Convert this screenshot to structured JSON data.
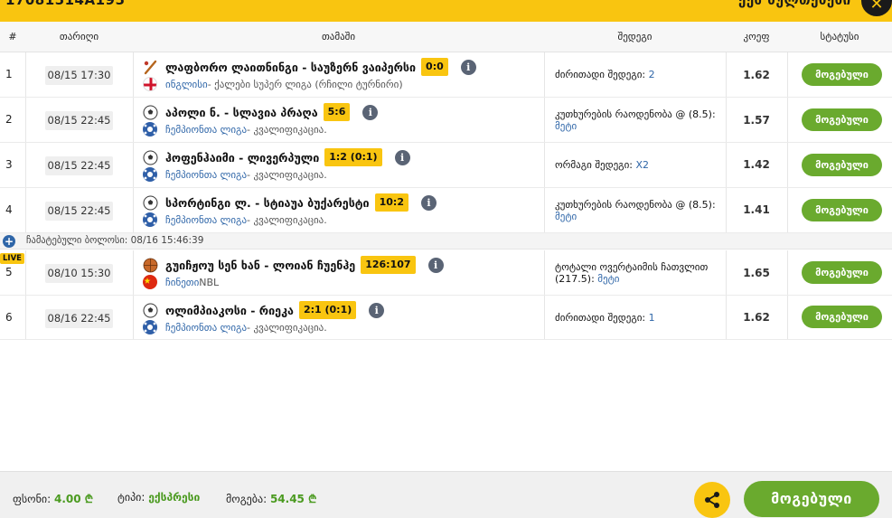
{
  "header": {
    "ticket_id": "17081514A195",
    "cashout_label": "ქეშ ბულთებები",
    "close_icon": "close-icon"
  },
  "columns": {
    "num": "#",
    "date": "თარიღი",
    "match": "თამაში",
    "result": "შედეგი",
    "odds": "კოეფ",
    "status": "სტატუსი"
  },
  "rows": [
    {
      "num": "1",
      "date": "08/15 17:30",
      "sport_icon": "cricket-icon",
      "teams": "ლაფბორო ლაითნინგი - საუზერნ ვაიპერსი",
      "score": "0:0",
      "flag_icon": "england-flag-icon",
      "league_country": "ინგლისი",
      "league_name": " - ქალები სუპერ ლიგა (რჩილი ტურნირი)",
      "market_label": "ძირითადი შედეგი: ",
      "market_sel": "2",
      "odds": "1.62",
      "status": "მოგებული"
    },
    {
      "num": "2",
      "date": "08/15 22:45",
      "sport_icon": "soccer-ball-icon",
      "teams": "აპოლი ნ. - სლავია პრაღა",
      "score": "5:6",
      "flag_icon": "globe-icon",
      "league_country": "ჩემპიონთა ლიგა",
      "league_name": " - კვალიფიკაცია.",
      "market_label": "კუთხურების რაოდენობა @ (8.5): ",
      "market_sel": "მეტი",
      "odds": "1.57",
      "status": "მოგებული"
    },
    {
      "num": "3",
      "date": "08/15 22:45",
      "sport_icon": "soccer-ball-icon",
      "teams": "ჰოფენჰაიმი - ლივერპული",
      "score": "1:2 (0:1)",
      "flag_icon": "globe-icon",
      "league_country": "ჩემპიონთა ლიგა",
      "league_name": " - კვალიფიკაცია.",
      "market_label": "ორმაგი შედეგი: ",
      "market_sel": "X2",
      "odds": "1.42",
      "status": "მოგებული"
    },
    {
      "num": "4",
      "date": "08/15 22:45",
      "sport_icon": "soccer-ball-icon",
      "teams": "სპორტინგი ლ. - სტიაუა ბუქარესტი",
      "score": "10:2",
      "flag_icon": "globe-icon",
      "league_country": "ჩემპიონთა ლიგა",
      "league_name": " - კვალიფიკაცია.",
      "market_label": "კუთხურების რაოდენობა @ (8.5): ",
      "market_sel": "მეტი",
      "odds": "1.41",
      "status": "მოგებული"
    },
    {
      "num": "5",
      "date": "08/10 15:30",
      "sport_icon": "basketball-icon",
      "teams": "გუიჩჟოუ სენ ხან - ლოიან ჩუენჰე",
      "score": "126:107",
      "flag_icon": "china-flag-icon",
      "league_country": "ჩინეთი",
      "league_name": "  NBL",
      "market_label": "ტოტალი ოვერტაიმის ჩათვლით (217.5): ",
      "market_sel": "მეტი",
      "odds": "1.65",
      "status": "მოგებული"
    },
    {
      "num": "6",
      "date": "08/16 22:45",
      "sport_icon": "soccer-ball-icon",
      "teams": "ოლიმპიაკოსი - რიეკა",
      "score": "2:1 (0:1)",
      "flag_icon": "globe-icon",
      "league_country": "ჩემპიონთა ლიგა",
      "league_name": " - კვალიფიკაცია.",
      "market_label": "ძირითადი შედეგი: ",
      "market_sel": "1",
      "odds": "1.62",
      "status": "მოგებული"
    }
  ],
  "notice": {
    "text": "ჩამატებული ბოლოსი: 08/16 15:46:39",
    "icon": "plus-circle-icon"
  },
  "live_badge": "LIVE",
  "footer": {
    "stake_label": "ფსონი:",
    "stake_value": "4.00 ₾",
    "type_label": "ტიპი:",
    "type_value": "ექსპრესი",
    "win_label": "მოგება:",
    "win_value": "54.45 ₾",
    "share_icon": "share-icon",
    "win_button": "მოგებული"
  },
  "colors": {
    "accent_yellow": "#f9c510",
    "win_green": "#6aaa2e",
    "link_blue": "#2f66a8"
  }
}
